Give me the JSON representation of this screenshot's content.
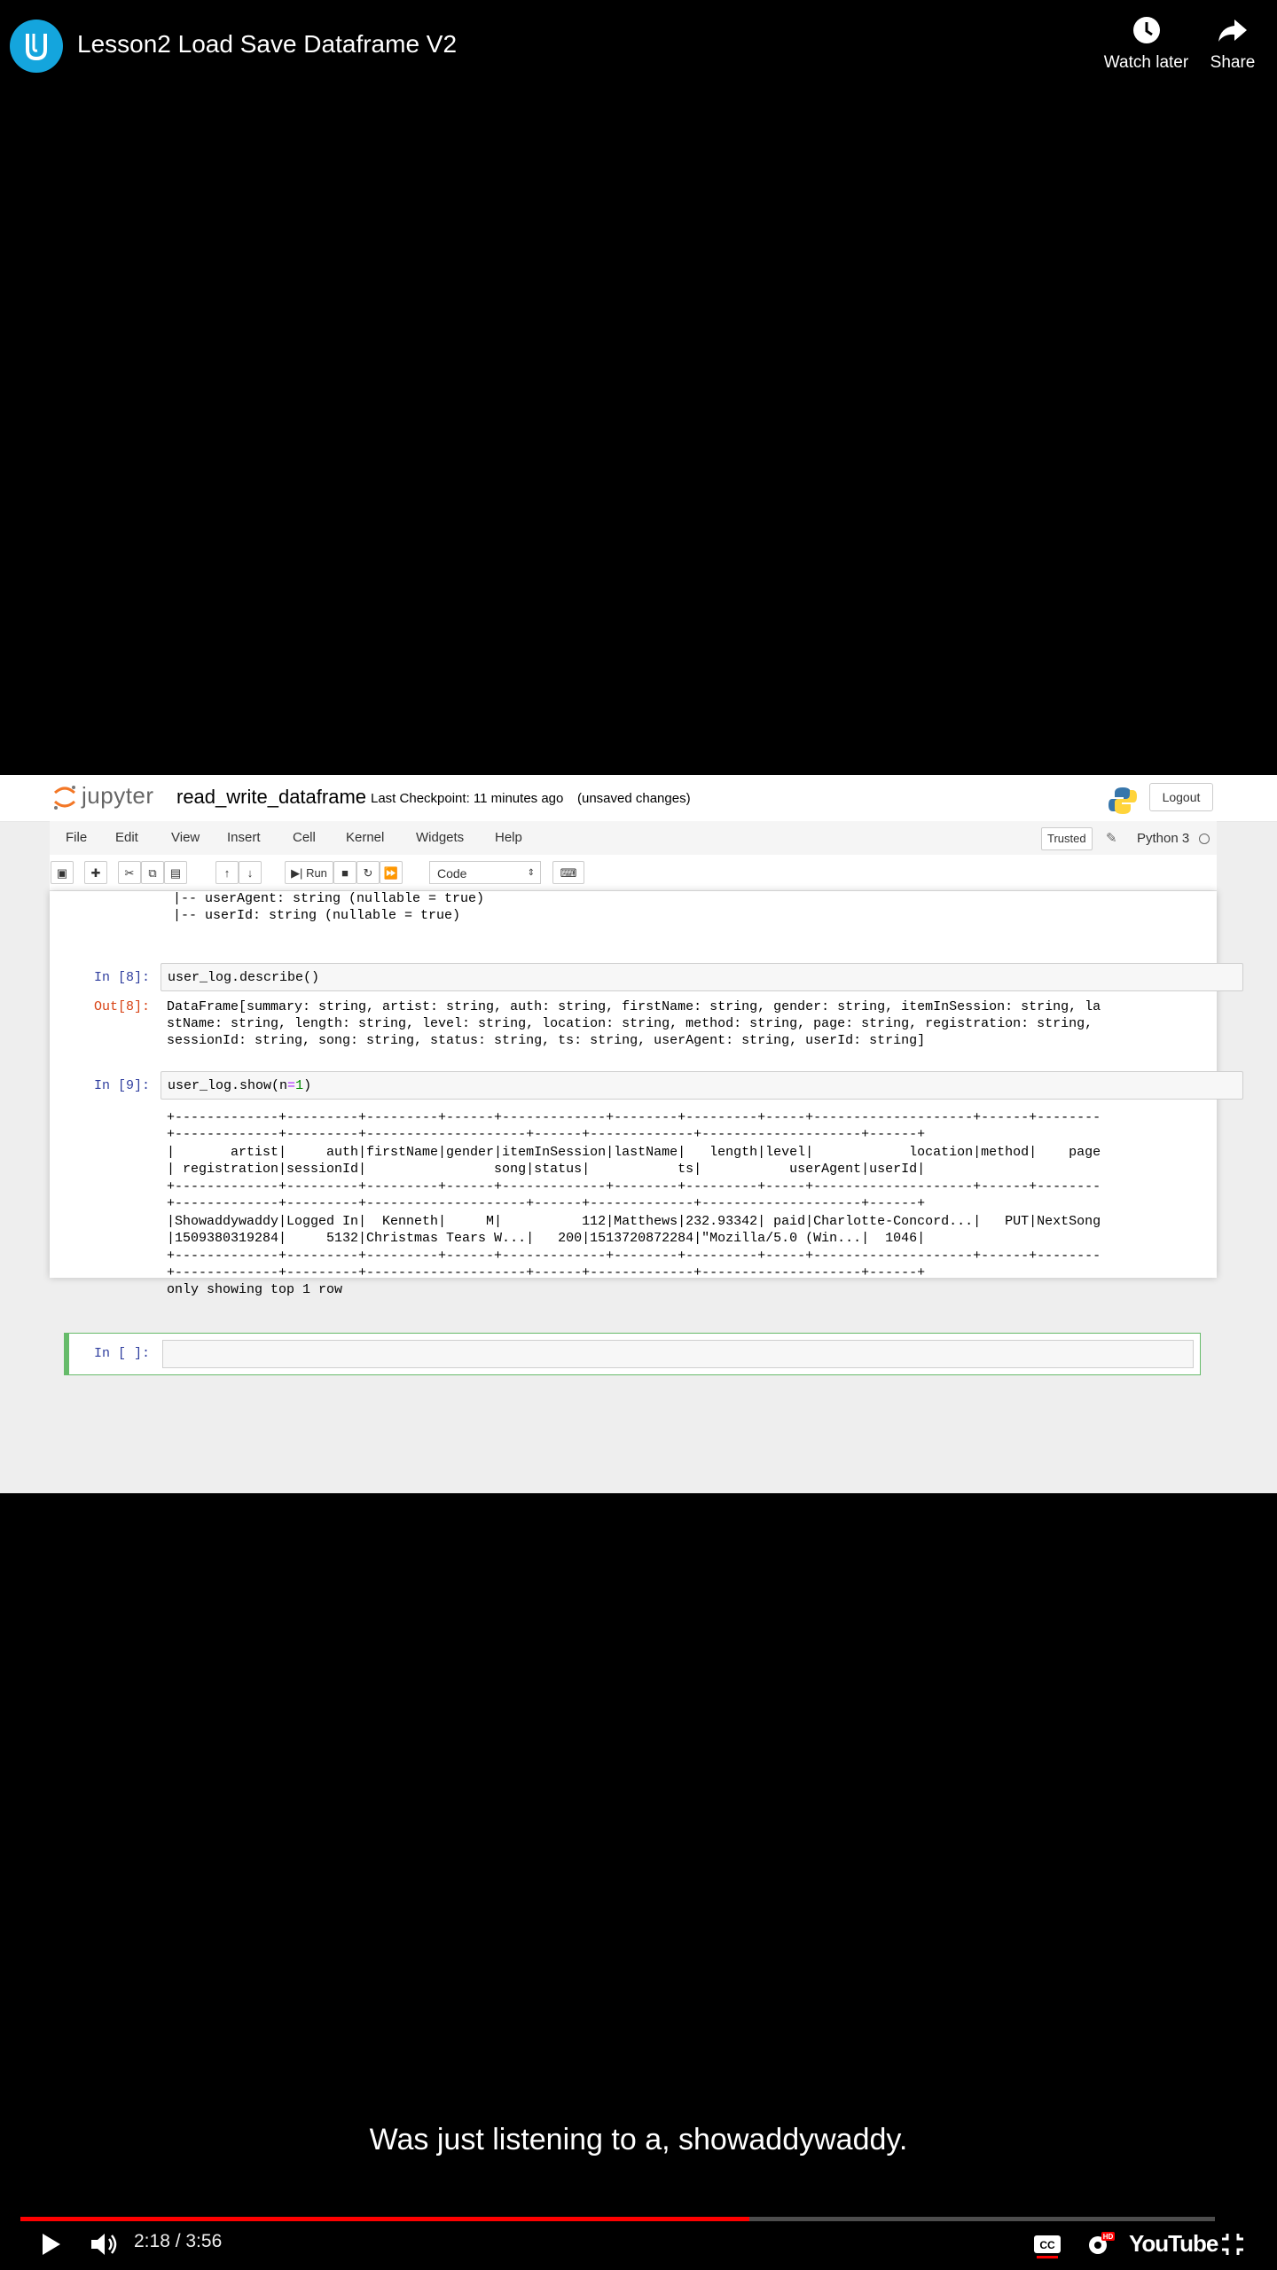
{
  "video": {
    "title": "Lesson2 Load Save Dataframe V2",
    "watch_later": "Watch later",
    "share": "Share",
    "caption": "Was just listening to a, showaddywaddy.",
    "time": "2:18 / 3:56",
    "progress": 0.61,
    "youtube_label": "YouTube",
    "brand_color": "#14a5dd"
  },
  "jupyter": {
    "logo_text": "jupyter",
    "notebook_name": "read_write_dataframe",
    "checkpoint": "Last Checkpoint: 11 minutes ago",
    "unsaved": "(unsaved changes)",
    "logout": "Logout",
    "menu": [
      "File",
      "Edit",
      "View",
      "Insert",
      "Cell",
      "Kernel",
      "Widgets",
      "Help"
    ],
    "trusted": "Trusted",
    "kernel": "Python 3",
    "run_label": "Run",
    "cell_type": "Code"
  },
  "cells": {
    "schema_lines": [
      " |-- userAgent: string (nullable = true)",
      " |-- userId: string (nullable = true)"
    ],
    "cell8_prompt": "In [8]:",
    "cell8_code": "user_log.describe()",
    "out8_prompt": "Out[8]:",
    "out8_lines": [
      "DataFrame[summary: string, artist: string, auth: string, firstName: string, gender: string, itemInSession: string, la",
      "stName: string, length: string, level: string, location: string, method: string, page: string, registration: string,",
      "sessionId: string, song: string, status: string, ts: string, userAgent: string, userId: string]"
    ],
    "cell9_prompt": "In [9]:",
    "cell9_code_prefix": "user_log.show(",
    "cell9_code_arg": "n",
    "cell9_code_eq": "=",
    "cell9_code_num": "1",
    "cell9_code_suffix": ")",
    "out9_lines": [
      "+-------------+---------+---------+------+-------------+--------+---------+-----+--------------------+------+--------",
      "+-------------+---------+--------------------+------+-------------+--------------------+------+",
      "|       artist|     auth|firstName|gender|itemInSession|lastName|   length|level|            location|method|    page",
      "| registration|sessionId|                song|status|           ts|           userAgent|userId|",
      "+-------------+---------+---------+------+-------------+--------+---------+-----+--------------------+------+--------",
      "+-------------+---------+--------------------+------+-------------+--------------------+------+",
      "|Showaddywaddy|Logged In|  Kenneth|     M|          112|Matthews|232.93342| paid|Charlotte-Concord...|   PUT|NextSong",
      "|1509380319284|     5132|Christmas Tears W...|   200|1513720872284|\"Mozilla/5.0 (Win...|  1046|",
      "+-------------+---------+---------+------+-------------+--------+---------+-----+--------------------+------+--------",
      "+-------------+---------+--------------------+------+-------------+--------------------+------+",
      "only showing top 1 row"
    ],
    "empty_prompt": "In [ ]:"
  }
}
